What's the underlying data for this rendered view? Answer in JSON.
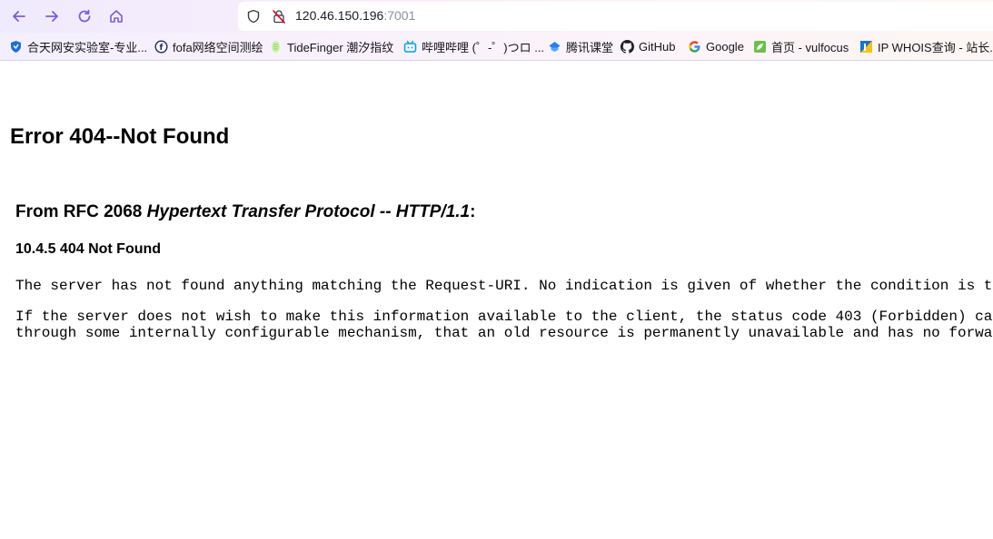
{
  "browser": {
    "url_host": "120.46.150.196",
    "url_port": ":7001"
  },
  "bookmarks": [
    {
      "label": "合天网安实验室-专业..."
    },
    {
      "label": "fofa网络空间测绘"
    },
    {
      "label": "TideFinger 潮汐指纹"
    },
    {
      "label": "哔哩哔哩 (゜-゜)つロ ..."
    },
    {
      "label": "腾讯课堂"
    },
    {
      "label": "GitHub"
    },
    {
      "label": "Google"
    },
    {
      "label": "首页 - vulfocus"
    },
    {
      "label": "IP WHOIS查询 - 站长..."
    }
  ],
  "page": {
    "title": "Error 404--Not Found",
    "rfc_prefix": "From RFC 2068 ",
    "rfc_italic": "Hypertext Transfer Protocol -- HTTP/1.1",
    "rfc_suffix": ":",
    "section": "10.4.5 404 Not Found",
    "para1": "The server has not found anything matching the Request-URI. No indication is given of whether the condition is t",
    "para2_line1": "If the server does not wish to make this information available to the client, the status code 403 (Forbidden) ca",
    "para2_line2": "through some internally configurable mechanism, that an old resource is permanently unavailable and has no forwa"
  }
}
